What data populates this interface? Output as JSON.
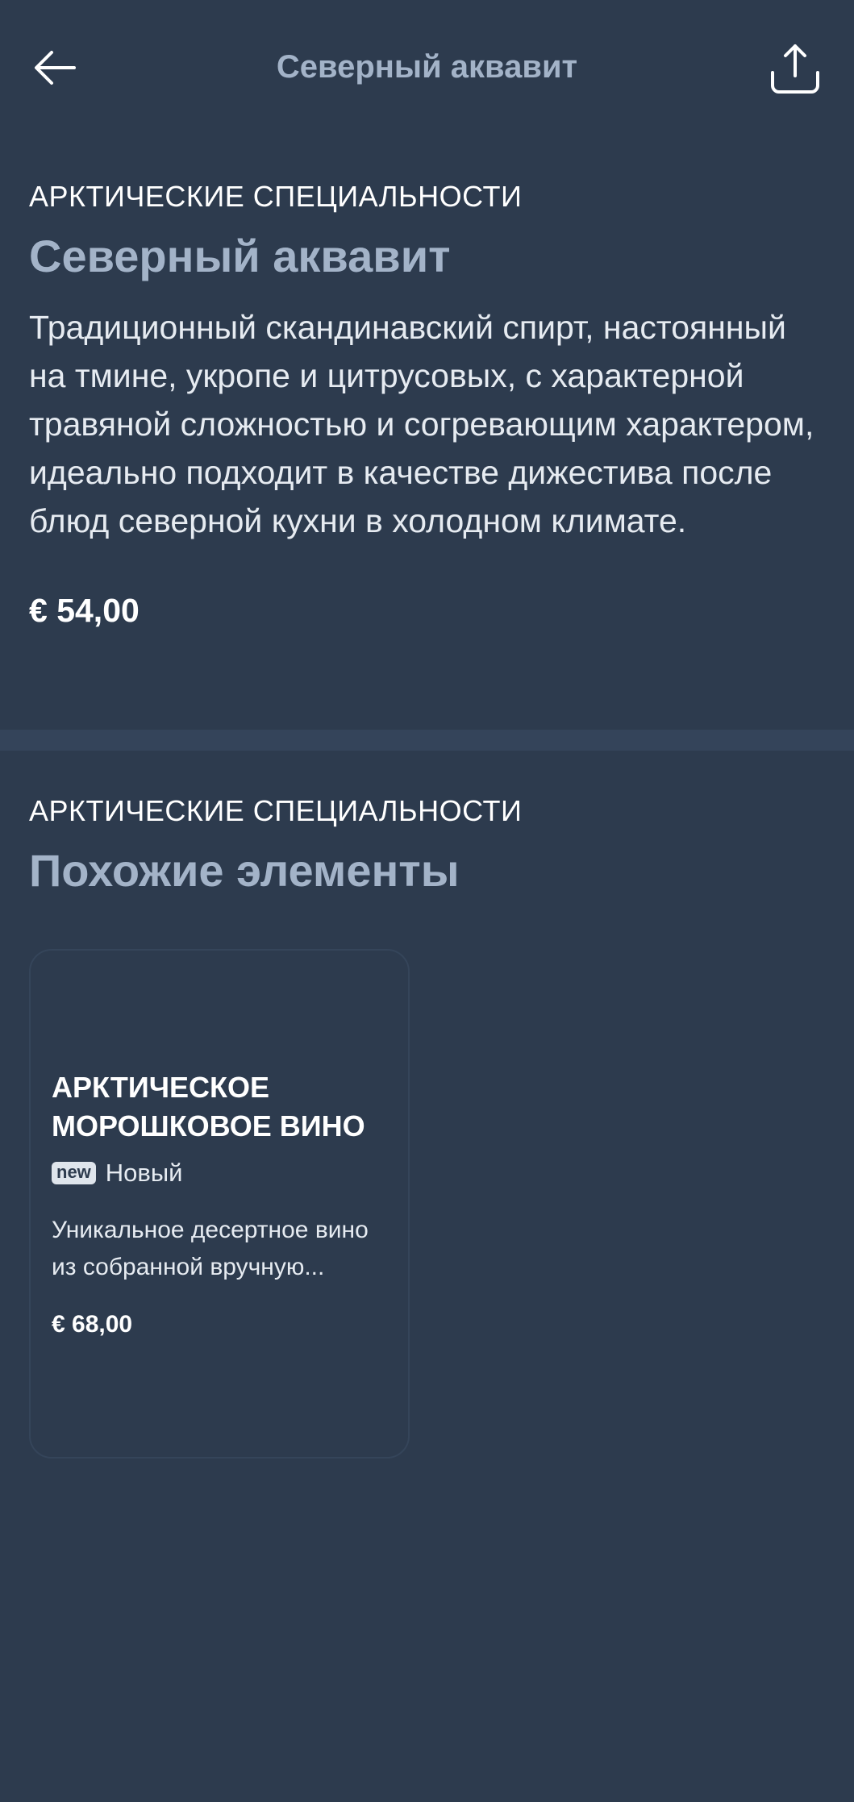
{
  "header": {
    "title": "Северный аквавит",
    "back_icon": "arrow-left-icon",
    "share_icon": "share-icon"
  },
  "product": {
    "category": "АРКТИЧЕСКИЕ СПЕЦИАЛЬНОСТИ",
    "name": "Северный аквавит",
    "description": "Традиционный скандинавский спирт, настоянный на тмине, укропе и цитрусовых, с характерной травяной сложностью и согревающим характером, идеально подходит в качестве дижестива после блюд северной кухни в холодном климате.",
    "price": "€ 54,00"
  },
  "related": {
    "category": "АРКТИЧЕСКИЕ СПЕЦИАЛЬНОСТИ",
    "heading": "Похожие элементы",
    "items": [
      {
        "title": "АРКТИЧЕСКОЕ МОРОШКОВОЕ ВИНО",
        "badge": "new",
        "badge_label": "Новый",
        "description": "Уникальное десертное вино из собранной вручную...",
        "price": "€ 68,00"
      }
    ]
  },
  "colors": {
    "background": "#2d3b4e",
    "divider": "#34445a",
    "muted_heading": "#a3b3c8",
    "text": "#ffffff"
  }
}
